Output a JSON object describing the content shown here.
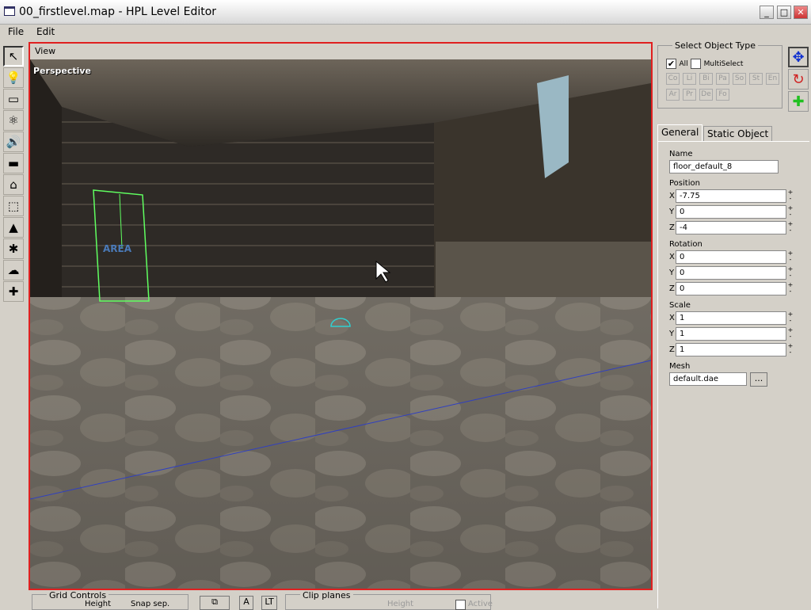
{
  "window": {
    "title": "00_firstlevel.map - HPL Level Editor"
  },
  "menu": [
    "File",
    "Edit"
  ],
  "toolbar_tools": [
    {
      "name": "select-tool",
      "glyph": "↖"
    },
    {
      "name": "light-tool",
      "glyph": "💡"
    },
    {
      "name": "billboard-tool",
      "glyph": "▭"
    },
    {
      "name": "particle-tool",
      "glyph": "⚛"
    },
    {
      "name": "sound-tool",
      "glyph": "🔊"
    },
    {
      "name": "static-object-tool",
      "glyph": "▬"
    },
    {
      "name": "area-tool",
      "glyph": "⌂"
    },
    {
      "name": "primitive-tool",
      "glyph": "⬚"
    },
    {
      "name": "entity-tool",
      "glyph": "▲"
    },
    {
      "name": "decal-tool",
      "glyph": "✱"
    },
    {
      "name": "fog-area-tool",
      "glyph": "☁"
    },
    {
      "name": "joint-tool",
      "glyph": "✚"
    }
  ],
  "viewport": {
    "label": "View",
    "camera": "Perspective",
    "area_label": "AREA"
  },
  "select_object_type": {
    "title": "Select Object Type",
    "all_label": "All",
    "all_checked": true,
    "multiselect_label": "MultiSelect",
    "types": [
      "Co",
      "Li",
      "Bi",
      "Pa",
      "So",
      "St",
      "En",
      "Ar",
      "Pr",
      "De",
      "Fo"
    ]
  },
  "tabs": [
    "General",
    "Static Object"
  ],
  "general": {
    "name_label": "Name",
    "name_value": "floor_default_8",
    "position_label": "Position",
    "position": {
      "x": "-7.75",
      "y": "0",
      "z": "-4"
    },
    "rotation_label": "Rotation",
    "rotation": {
      "x": "0",
      "y": "0",
      "z": "0"
    },
    "scale_label": "Scale",
    "scale": {
      "x": "1",
      "y": "1",
      "z": "1"
    },
    "mesh_label": "Mesh",
    "mesh_value": "default.dae",
    "browse_label": "...",
    "axes": [
      "X",
      "Y",
      "Z"
    ]
  },
  "bottom": {
    "grid_controls": "Grid Controls",
    "height": "Height",
    "snap_sep": "Snap sep.",
    "a_label": "A",
    "lt_label": "LT",
    "clip_planes": "Clip planes",
    "clip_height": "Height",
    "active": "Active"
  }
}
